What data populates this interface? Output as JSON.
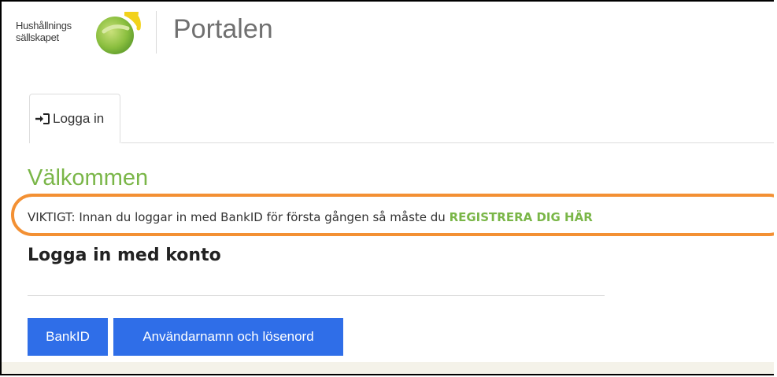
{
  "header": {
    "logo": {
      "line1": "Hushållnings",
      "line2": "sällskapet"
    },
    "app_title": "Portalen"
  },
  "tabs": [
    {
      "label": "Logga in",
      "icon": "sign-in-icon",
      "active": true
    }
  ],
  "main": {
    "welcome": "Välkommen",
    "notice": {
      "text": "VIKTIGT: Innan du loggar in med BankID för första gången så måste du ",
      "link": "REGISTRERA DIG HÄR"
    },
    "login_heading": "Logga in med konto",
    "buttons": {
      "bankid": "BankID",
      "userpass": "Användarnamn och lösenord"
    }
  },
  "colors": {
    "accent_green": "#7ab648",
    "button_blue": "#2f6ee8",
    "highlight_orange": "#f39033",
    "footer_band": "#f4f2e9"
  }
}
